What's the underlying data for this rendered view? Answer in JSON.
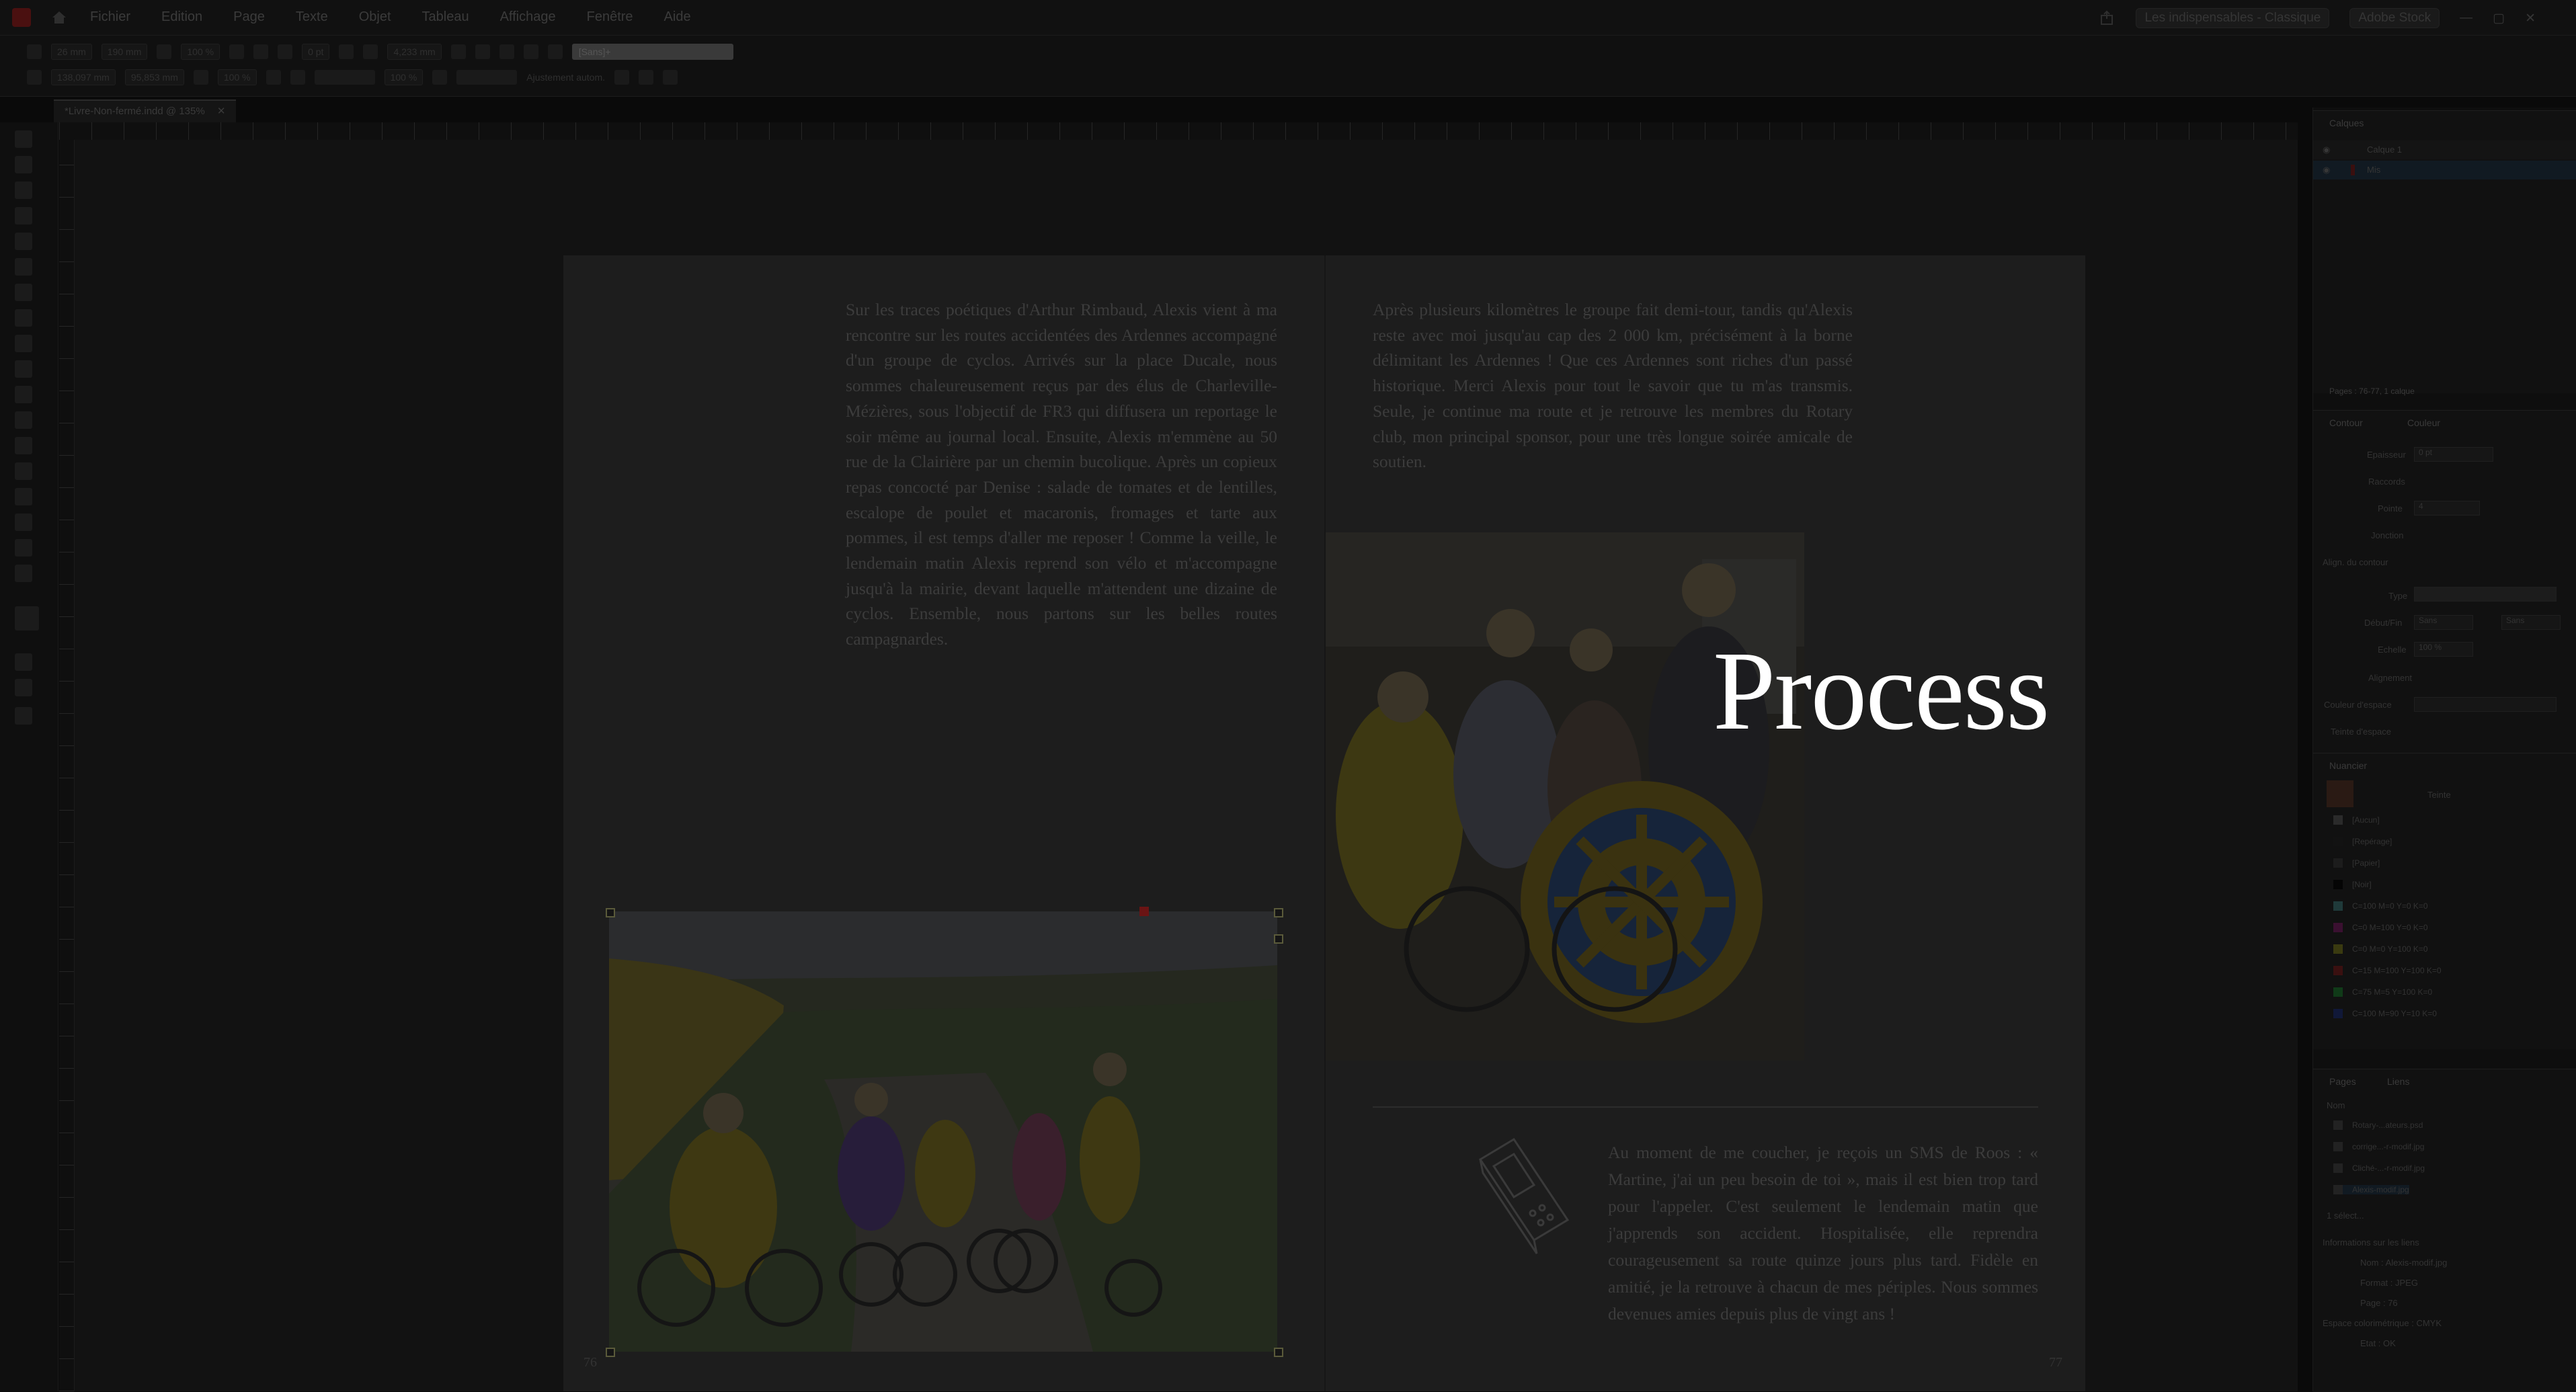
{
  "menubar": {
    "items": [
      "Fichier",
      "Edition",
      "Page",
      "Texte",
      "Objet",
      "Tableau",
      "Affichage",
      "Fenêtre",
      "Aide"
    ],
    "workspace": "Les indispensables - Classique",
    "search_placeholder": "Adobe Stock"
  },
  "control": {
    "x": "26 mm",
    "y": "138,097 mm",
    "w": "190 mm",
    "h": "95,853 mm",
    "scale_x": "100 %",
    "scale_y": "100 %",
    "stroke": "0 pt",
    "opacity": "100 %",
    "dim": "4,233 mm",
    "autofit": "Ajustement autom.",
    "style": "[Sans]+"
  },
  "document": {
    "tab_title": "*Livre-Non-fermé.indd @ 135%"
  },
  "spread": {
    "left_page": {
      "text": "Sur les traces poétiques d'Arthur Rimbaud, Alexis vient à ma rencontre sur les routes accidentées des Ardennes accompagné d'un groupe de cyclos. Arrivés sur la place Ducale, nous sommes chaleureusement reçus par des élus de Charleville-Mézières, sous l'objectif de FR3 qui diffusera un reportage le soir même au journal local. Ensuite, Alexis m'emmène au 50 rue de la Clairière par un chemin bucolique. Après un copieux repas concocté par Denise : salade de tomates et de lentilles, escalope de poulet et macaronis, fromages et tarte aux pommes, il est temps d'aller me reposer ! Comme la veille, le lendemain matin Alexis reprend son vélo et m'accompagne jusqu'à la mairie, devant laquelle m'attendent une dizaine de cyclos. Ensemble, nous partons sur les belles routes campagnardes.",
      "folio": "76"
    },
    "right_page": {
      "text_top": "Après plusieurs kilomètres le groupe fait demi-tour, tandis qu'Alexis reste avec moi jusqu'au cap des 2 000 km, précisément à la borne délimitant les Ardennes ! Que ces Ardennes sont riches d'un passé historique. Merci Alexis pour tout le savoir que tu m'as transmis. Seule, je continue ma route et je retrouve les membres du Rotary club, mon principal sponsor, pour une très longue soirée amicale de soutien.",
      "text_bottom": "Au moment de me coucher, je reçois un SMS de Roos : « Martine, j'ai un peu besoin de toi », mais il est bien trop tard pour l'appeler. C'est seulement le lendemain matin que j'apprends son accident. Hospitalisée, elle reprendra courageusement sa route quinze jours plus tard. Fidèle en amitié, je la retrouve à chacun de mes périples. Nous sommes devenues amies depuis plus de vingt ans !",
      "folio": "77"
    },
    "overlay_heading": "Process"
  },
  "panels": {
    "layers": {
      "title": "Calques",
      "items": [
        "Calque 1",
        "Mis"
      ],
      "footer": "Pages : 76-77, 1 calque"
    },
    "stroke": {
      "tabs": [
        "Contour",
        "Couleur"
      ],
      "labels": [
        "Epaisseur",
        "Raccords",
        "Pointe",
        "Jonction",
        "Align. du contour",
        "Type",
        "Début/Fin",
        "Echelle",
        "Alignement",
        "Couleur d'espace",
        "Teinte d'espace"
      ],
      "weight": "0 pt",
      "miter": "4",
      "start": "Sans",
      "end": "Sans",
      "scale": "100 %"
    },
    "swatches": {
      "title": "Nuancier",
      "tint_label": "Teinte",
      "items": [
        "[Aucun]",
        "[Repérage]",
        "[Papier]",
        "[Noir]",
        "C=100 M=0 Y=0 K=0",
        "C=0 M=100 Y=0 K=0",
        "C=0 M=0 Y=100 K=0",
        "C=15 M=100 Y=100 K=0",
        "C=75 M=5 Y=100 K=0",
        "C=100 M=90 Y=10 K=0"
      ],
      "colors": [
        "#2a2a2a",
        "#121212",
        "#1c1c1c",
        "#050505",
        "#1f3a3a",
        "#3a1030",
        "#3a3a10",
        "#3a1010",
        "#103a18",
        "#101838"
      ]
    },
    "links": {
      "tabs": [
        "Pages",
        "Liens"
      ],
      "header": "Nom",
      "items": [
        "Rotary-...ateurs.psd",
        "corrige...-r-modif.jpg",
        "Cliché-...-r-modif.jpg",
        "Alexis-modif.jpg"
      ],
      "selected_count": "1 sélect...",
      "info_title": "Informations sur les liens",
      "info": [
        "Nom : Alexis-modif.jpg",
        "Format : JPEG",
        "Page : 76",
        "Espace colorimétrique : CMYK",
        "Etat : OK"
      ]
    }
  }
}
